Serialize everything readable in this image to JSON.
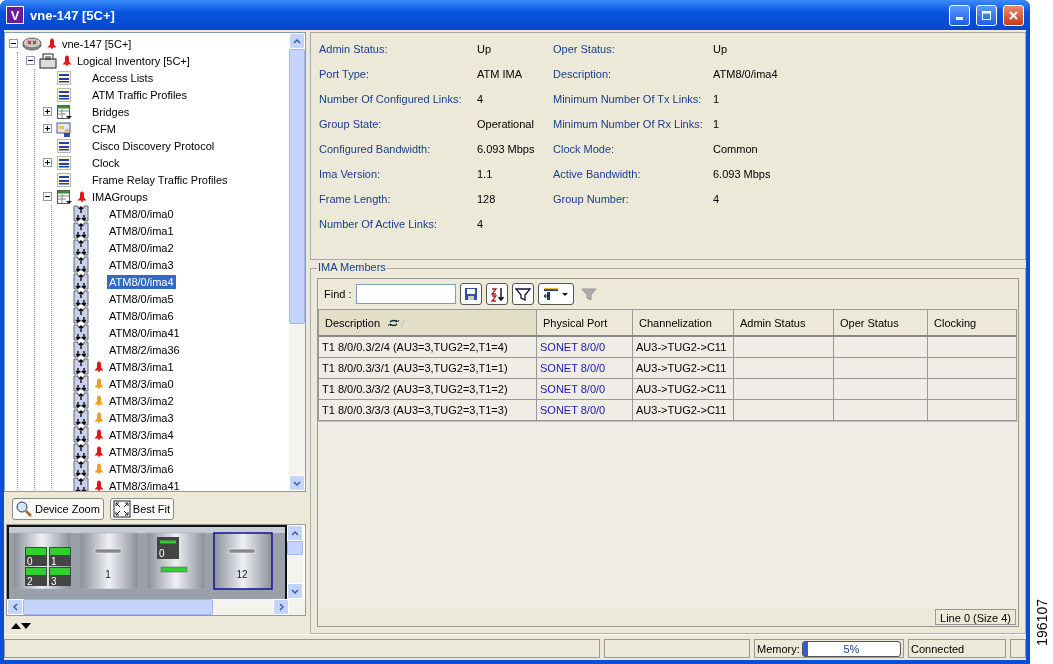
{
  "window": {
    "app_icon": "V",
    "title": "vne-147 [5C+]"
  },
  "tree": [
    {
      "label": "vne-147 [5C+]",
      "kind": "device",
      "color": "#e01818",
      "expanded": true,
      "children": [
        {
          "label": "Logical Inventory [5C+]",
          "kind": "inventory",
          "color": "#e01818",
          "expanded": true,
          "children": [
            {
              "label": "Access Lists",
              "kind": "table"
            },
            {
              "label": "ATM Traffic Profiles",
              "kind": "table"
            },
            {
              "label": "Bridges",
              "kind": "table-arrows",
              "expanded": false
            },
            {
              "label": "CFM",
              "kind": "cfm",
              "expanded": false
            },
            {
              "label": "Cisco Discovery Protocol",
              "kind": "table"
            },
            {
              "label": "Clock",
              "kind": "table",
              "expanded": false
            },
            {
              "label": "Frame Relay Traffic Profiles",
              "kind": "table"
            },
            {
              "label": "IMAGroups",
              "kind": "table-arrows",
              "color": "#e01818",
              "expanded": true,
              "children": [
                {
                  "label": "ATM8/0/ima0",
                  "kind": "ima",
                  "selected": false
                },
                {
                  "label": "ATM8/0/ima1",
                  "kind": "ima",
                  "selected": false
                },
                {
                  "label": "ATM8/0/ima2",
                  "kind": "ima",
                  "selected": false
                },
                {
                  "label": "ATM8/0/ima3",
                  "kind": "ima",
                  "selected": false
                },
                {
                  "label": "ATM8/0/ima4",
                  "kind": "ima",
                  "selected": true
                },
                {
                  "label": "ATM8/0/ima5",
                  "kind": "ima",
                  "selected": false
                },
                {
                  "label": "ATM8/0/ima6",
                  "kind": "ima",
                  "selected": false
                },
                {
                  "label": "ATM8/0/ima41",
                  "kind": "ima",
                  "selected": false
                },
                {
                  "label": "ATM8/2/ima36",
                  "kind": "ima",
                  "selected": false
                },
                {
                  "label": "ATM8/3/ima1",
                  "kind": "ima",
                  "color": "#e01818",
                  "selected": false
                },
                {
                  "label": "ATM8/3/ima0",
                  "kind": "ima",
                  "color": "#f0a020",
                  "selected": false
                },
                {
                  "label": "ATM8/3/ima2",
                  "kind": "ima",
                  "color": "#f0a020",
                  "selected": false
                },
                {
                  "label": "ATM8/3/ima3",
                  "kind": "ima",
                  "color": "#f0a020",
                  "selected": false
                },
                {
                  "label": "ATM8/3/ima4",
                  "kind": "ima",
                  "color": "#e01818",
                  "selected": false
                },
                {
                  "label": "ATM8/3/ima5",
                  "kind": "ima",
                  "color": "#e01818",
                  "selected": false
                },
                {
                  "label": "ATM8/3/ima6",
                  "kind": "ima",
                  "color": "#f0a020",
                  "selected": false
                },
                {
                  "label": "ATM8/3/ima41",
                  "kind": "ima",
                  "color": "#e01818",
                  "selected": false
                }
              ]
            }
          ]
        }
      ]
    }
  ],
  "device_view": {
    "buttons": [
      {
        "label": "Device Zoom",
        "kind": "zoom"
      },
      {
        "label": "Best Fit",
        "kind": "fit"
      }
    ],
    "slots": [
      {
        "kind": "ports",
        "ports": [
          "0",
          "1",
          "2",
          "3"
        ],
        "selected": false
      },
      {
        "kind": "blank",
        "label": "1",
        "selected": false
      },
      {
        "kind": "module",
        "ports": [
          "0"
        ],
        "selected": false
      },
      {
        "kind": "blank",
        "label": "12",
        "selected": true
      }
    ]
  },
  "properties": [
    {
      "label": "Admin Status:",
      "value": "Up"
    },
    {
      "label": "Oper Status:",
      "value": "Up"
    },
    {
      "label": "Port Type:",
      "value": "ATM IMA"
    },
    {
      "label": "Description:",
      "value": "ATM8/0/ima4"
    },
    {
      "label": "Number Of Configured Links:",
      "value": "4"
    },
    {
      "label": "Minimum Number Of Tx Links:",
      "value": "1"
    },
    {
      "label": "Group State:",
      "value": "Operational"
    },
    {
      "label": "Minimum Number Of Rx Links:",
      "value": "1"
    },
    {
      "label": "Configured Bandwidth:",
      "value": "6.093 Mbps"
    },
    {
      "label": "Clock Mode:",
      "value": "Common"
    },
    {
      "label": "Ima Version:",
      "value": "1.1"
    },
    {
      "label": "Active Bandwidth:",
      "value": "6.093 Mbps"
    },
    {
      "label": "Frame Length:",
      "value": "128"
    },
    {
      "label": "Group Number:",
      "value": "4"
    },
    {
      "label": "Number Of Active Links:",
      "value": "4"
    }
  ],
  "ima_members": {
    "title": "IMA Members",
    "find_label": "Find :",
    "tools": [
      {
        "kind": "save",
        "disabled": false
      },
      {
        "kind": "sort",
        "disabled": false
      },
      {
        "kind": "filter",
        "disabled": false
      },
      {
        "kind": "columns",
        "disabled": false
      },
      {
        "kind": "clear-filter",
        "disabled": true
      }
    ],
    "columns": [
      {
        "label": "Description",
        "sorted": true
      },
      {
        "label": "Physical Port",
        "sorted": false
      },
      {
        "label": "Channelization",
        "sorted": false
      },
      {
        "label": "Admin Status",
        "sorted": false
      },
      {
        "label": "Oper Status",
        "sorted": false
      },
      {
        "label": "Clocking",
        "sorted": false
      }
    ],
    "rows": [
      [
        "T1 8/0/0.3/2/4 (AU3=3,TUG2=2,T1=4)",
        "SONET 8/0/0",
        "AU3->TUG2->C11",
        "",
        "",
        ""
      ],
      [
        "T1 8/0/0.3/3/1 (AU3=3,TUG2=3,T1=1)",
        "SONET 8/0/0",
        "AU3->TUG2->C11",
        "",
        "",
        ""
      ],
      [
        "T1 8/0/0.3/3/2 (AU3=3,TUG2=3,T1=2)",
        "SONET 8/0/0",
        "AU3->TUG2->C11",
        "",
        "",
        ""
      ],
      [
        "T1 8/0/0.3/3/3 (AU3=3,TUG2=3,T1=3)",
        "SONET 8/0/0",
        "AU3->TUG2->C11",
        "",
        "",
        ""
      ]
    ],
    "footer": "Line 0 (Size 4)"
  },
  "status_bar": {
    "memory_label": "Memory:",
    "memory": {
      "level": 0.05,
      "reading": "5%"
    },
    "connection": "Connected"
  },
  "figure_number": "196107"
}
